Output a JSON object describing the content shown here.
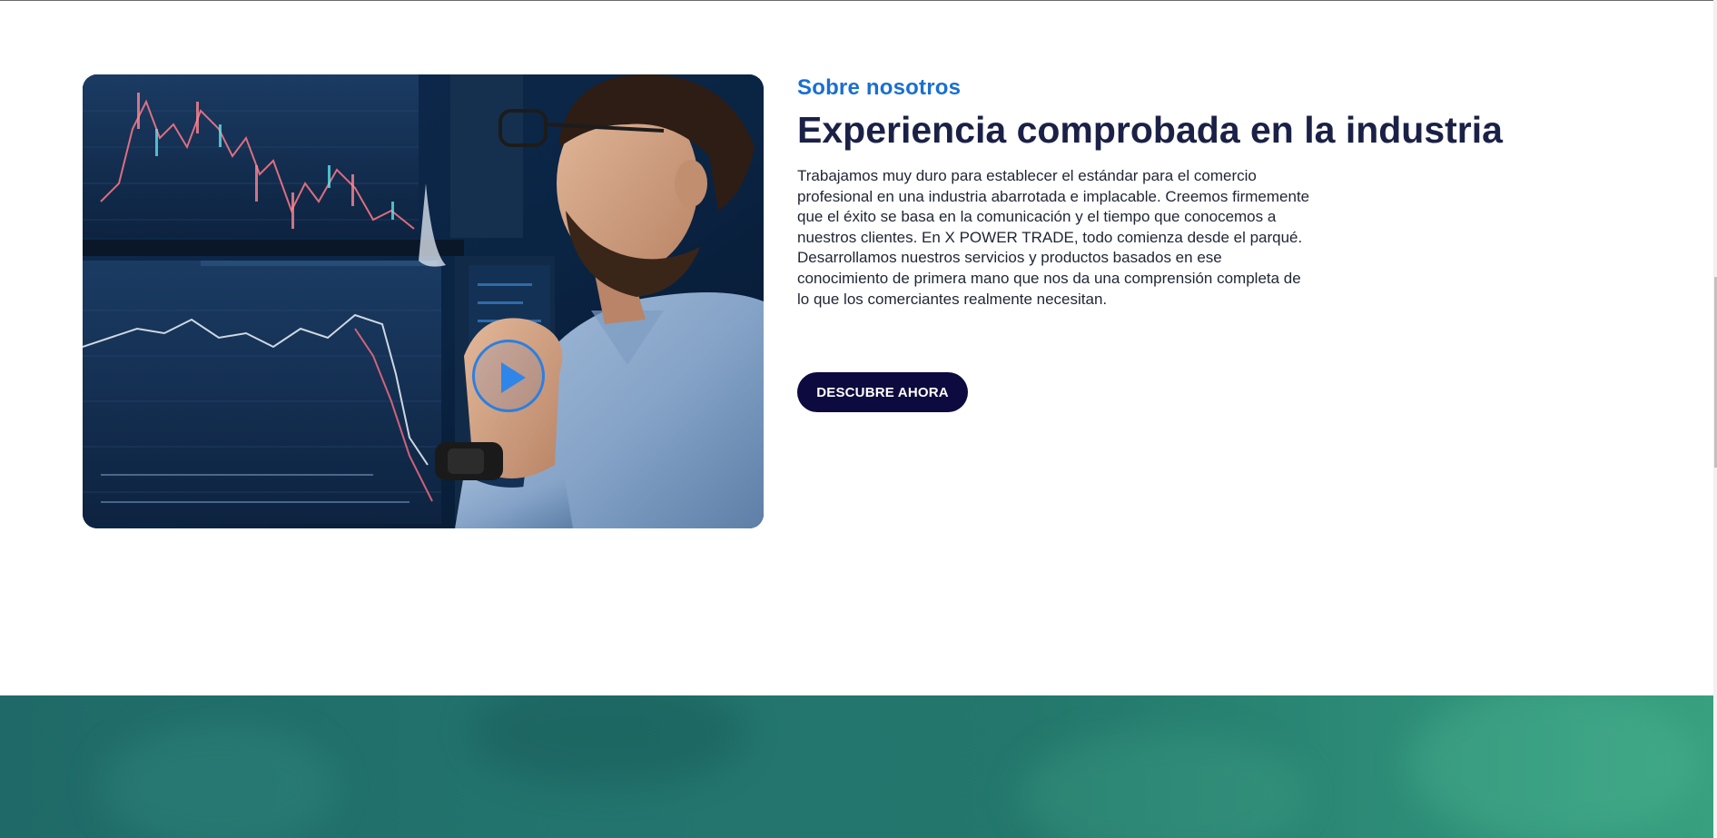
{
  "about": {
    "eyebrow": "Sobre nosotros",
    "headline": "Experiencia comprobada en la industria",
    "body": "Trabajamos muy duro para establecer el estándar para el comercio profesional en una industria abarrotada e implacable. Creemos firmemente que el éxito se basa en la comunicación y el tiempo que conocemos a nuestros clientes. En X POWER TRADE, todo comienza desde el parqué. Desarrollamos nuestros servicios y productos basados en ese conocimiento de primera mano que nos da una comprensión completa de lo que los comerciantes realmente necesitan.",
    "cta_label": "DESCUBRE AHORA"
  },
  "media": {
    "play_icon": "play-icon"
  },
  "colors": {
    "accent_blue": "#1a6fd1",
    "headline_navy": "#1b2146",
    "button_navy": "#0c0a3e",
    "teal": "#23746e"
  }
}
